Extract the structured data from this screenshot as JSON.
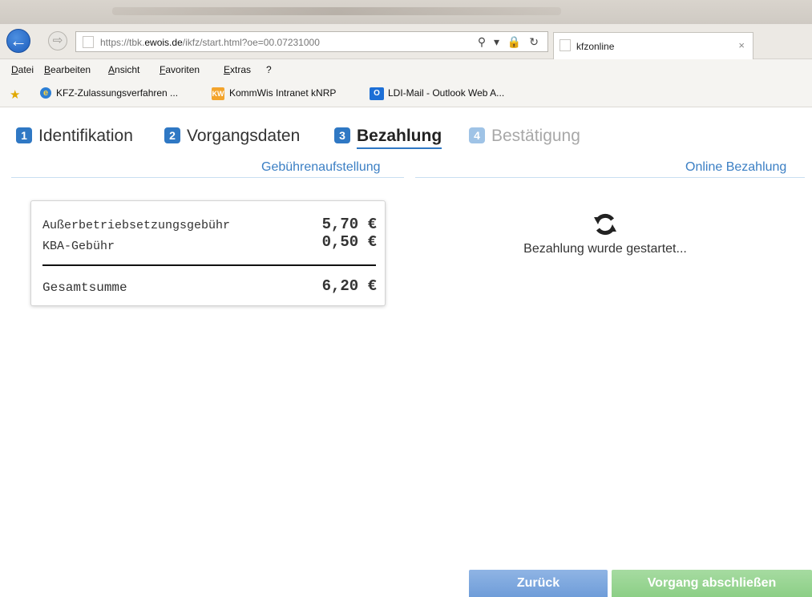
{
  "browser": {
    "url_prefix": "https://",
    "url_host_pre": "tbk.",
    "url_host_main": "ewois.de",
    "url_path": "/ikfz/start.html?oe=00.07231000",
    "address_icons": "⚲ ▾ 🔒 ↻",
    "tab_title": "kfzonline",
    "tab_close": "×",
    "back_glyph": "←",
    "forward_glyph": "⇨"
  },
  "menu": [
    "Datei",
    "Bearbeiten",
    "Ansicht",
    "Favoriten",
    "Extras",
    "?"
  ],
  "favorites": [
    {
      "label": "KFZ-Zulassungsverfahren ...",
      "icon": "ie-icon"
    },
    {
      "label": "KommWis Intranet kNRP",
      "icon": "kommwis-icon"
    },
    {
      "label": "LDI-Mail - Outlook Web A...",
      "icon": "outlook-icon"
    }
  ],
  "steps": [
    {
      "num": "1",
      "label": "Identifikation",
      "state": "done"
    },
    {
      "num": "2",
      "label": "Vorgangsdaten",
      "state": "done"
    },
    {
      "num": "3",
      "label": "Bezahlung",
      "state": "active"
    },
    {
      "num": "4",
      "label": "Bestätigung",
      "state": "disabled"
    }
  ],
  "sections": {
    "fees_title": "Gebührenaufstellung",
    "payment_title": "Online Bezahlung"
  },
  "fees": {
    "items": [
      {
        "label": "Außerbetriebsetzungsgebühr",
        "amount": "5,70 €"
      },
      {
        "label": "KBA-Gebühr",
        "amount": "0,50 €"
      }
    ],
    "total_label": "Gesamtsumme",
    "total_amount": "6,20 €"
  },
  "payment": {
    "status_text": "Bezahlung wurde gestartet..."
  },
  "buttons": {
    "back": "Zurück",
    "finish": "Vorgang abschließen"
  },
  "colors": {
    "accent": "#2f78c4",
    "link": "#3b7fc4",
    "back_button": "#7fa9df",
    "finish_button": "#96d590"
  }
}
